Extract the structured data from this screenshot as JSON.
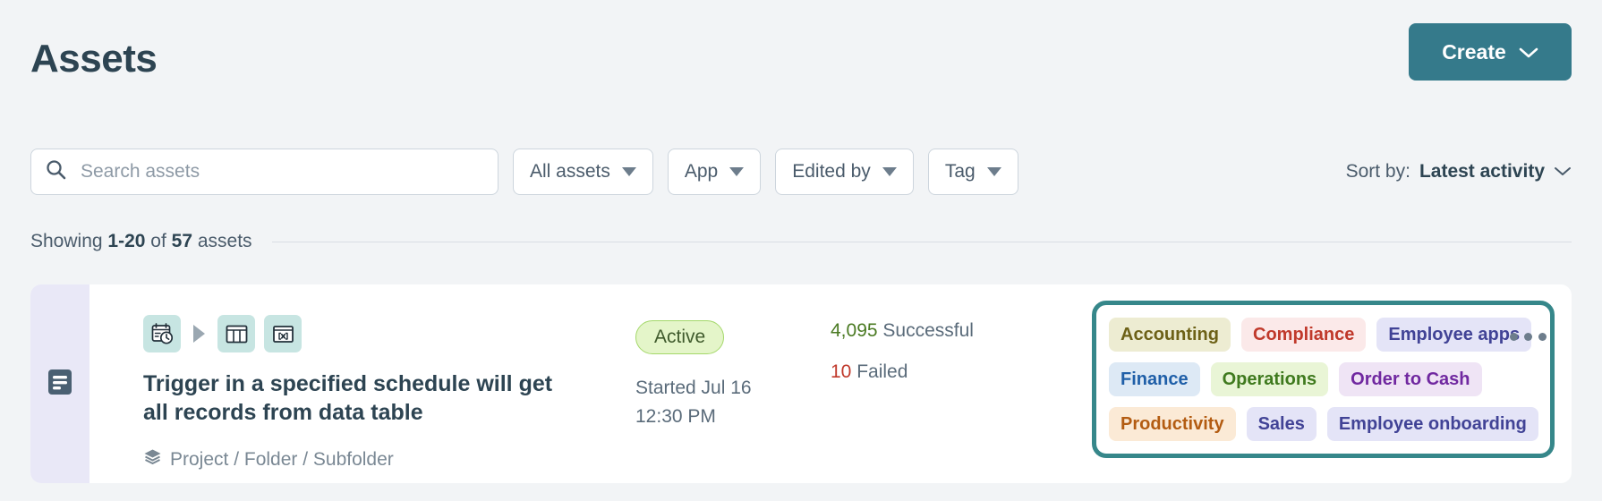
{
  "header": {
    "title": "Assets",
    "create_label": "Create",
    "create_icon": "chevron-down-icon",
    "create_color": "#357a8b"
  },
  "search": {
    "icon": "search-icon",
    "placeholder": "Search assets",
    "value": ""
  },
  "filters": [
    {
      "label": "All assets",
      "icon": "caret-down-icon"
    },
    {
      "label": "App",
      "icon": "caret-down-icon"
    },
    {
      "label": "Edited by",
      "icon": "caret-down-icon"
    },
    {
      "label": "Tag",
      "icon": "caret-down-icon"
    }
  ],
  "sort": {
    "label": "Sort by:",
    "value": "Latest activity",
    "icon": "chevron-down-icon"
  },
  "results": {
    "prefix": "Showing",
    "range": "1-20",
    "middle": "of",
    "total": "57",
    "suffix": "assets"
  },
  "asset": {
    "accent_icon": "document-lines-icon",
    "accent_color": "#e9e8f7",
    "flow_icons": [
      {
        "name": "schedule-trigger-icon"
      },
      {
        "name": "arrow-right-icon"
      },
      {
        "name": "data-table-icon"
      },
      {
        "name": "expression-icon"
      }
    ],
    "title": "Trigger in a specified schedule will get all records from data table",
    "breadcrumb_icon": "layers-icon",
    "breadcrumb": "Project / Folder / Subfolder",
    "status": "Active",
    "status_bg": "#e4f5c9",
    "status_border": "#a4d86a",
    "started": "Started Jul 16 12:30 PM",
    "runs": [
      {
        "count": "4,095",
        "label": "Successful",
        "count_color": "#4a7a22"
      },
      {
        "count": "10",
        "label": "Failed",
        "count_color": "#c0392b"
      }
    ],
    "tags_highlight_color": "#36878a",
    "tags": [
      {
        "label": "Accounting",
        "bg": "#edecd2",
        "fg": "#6d6117"
      },
      {
        "label": "Compliance",
        "bg": "#fbe9e9",
        "fg": "#c0392b"
      },
      {
        "label": "Employee apps",
        "bg": "#e4e4f7",
        "fg": "#414396"
      },
      {
        "label": "Finance",
        "bg": "#dde9f5",
        "fg": "#1f5fa8"
      },
      {
        "label": "Operations",
        "bg": "#e9f5d6",
        "fg": "#3f7a1e"
      },
      {
        "label": "Order to Cash",
        "bg": "#efe4f5",
        "fg": "#7028a0"
      },
      {
        "label": "Productivity",
        "bg": "#fbead6",
        "fg": "#b35c12"
      },
      {
        "label": "Sales",
        "bg": "#e4e4f7",
        "fg": "#414396"
      },
      {
        "label": "Employee onboarding",
        "bg": "#e4e4f7",
        "fg": "#414396"
      }
    ],
    "overflow_icon": "ellipsis-icon"
  }
}
